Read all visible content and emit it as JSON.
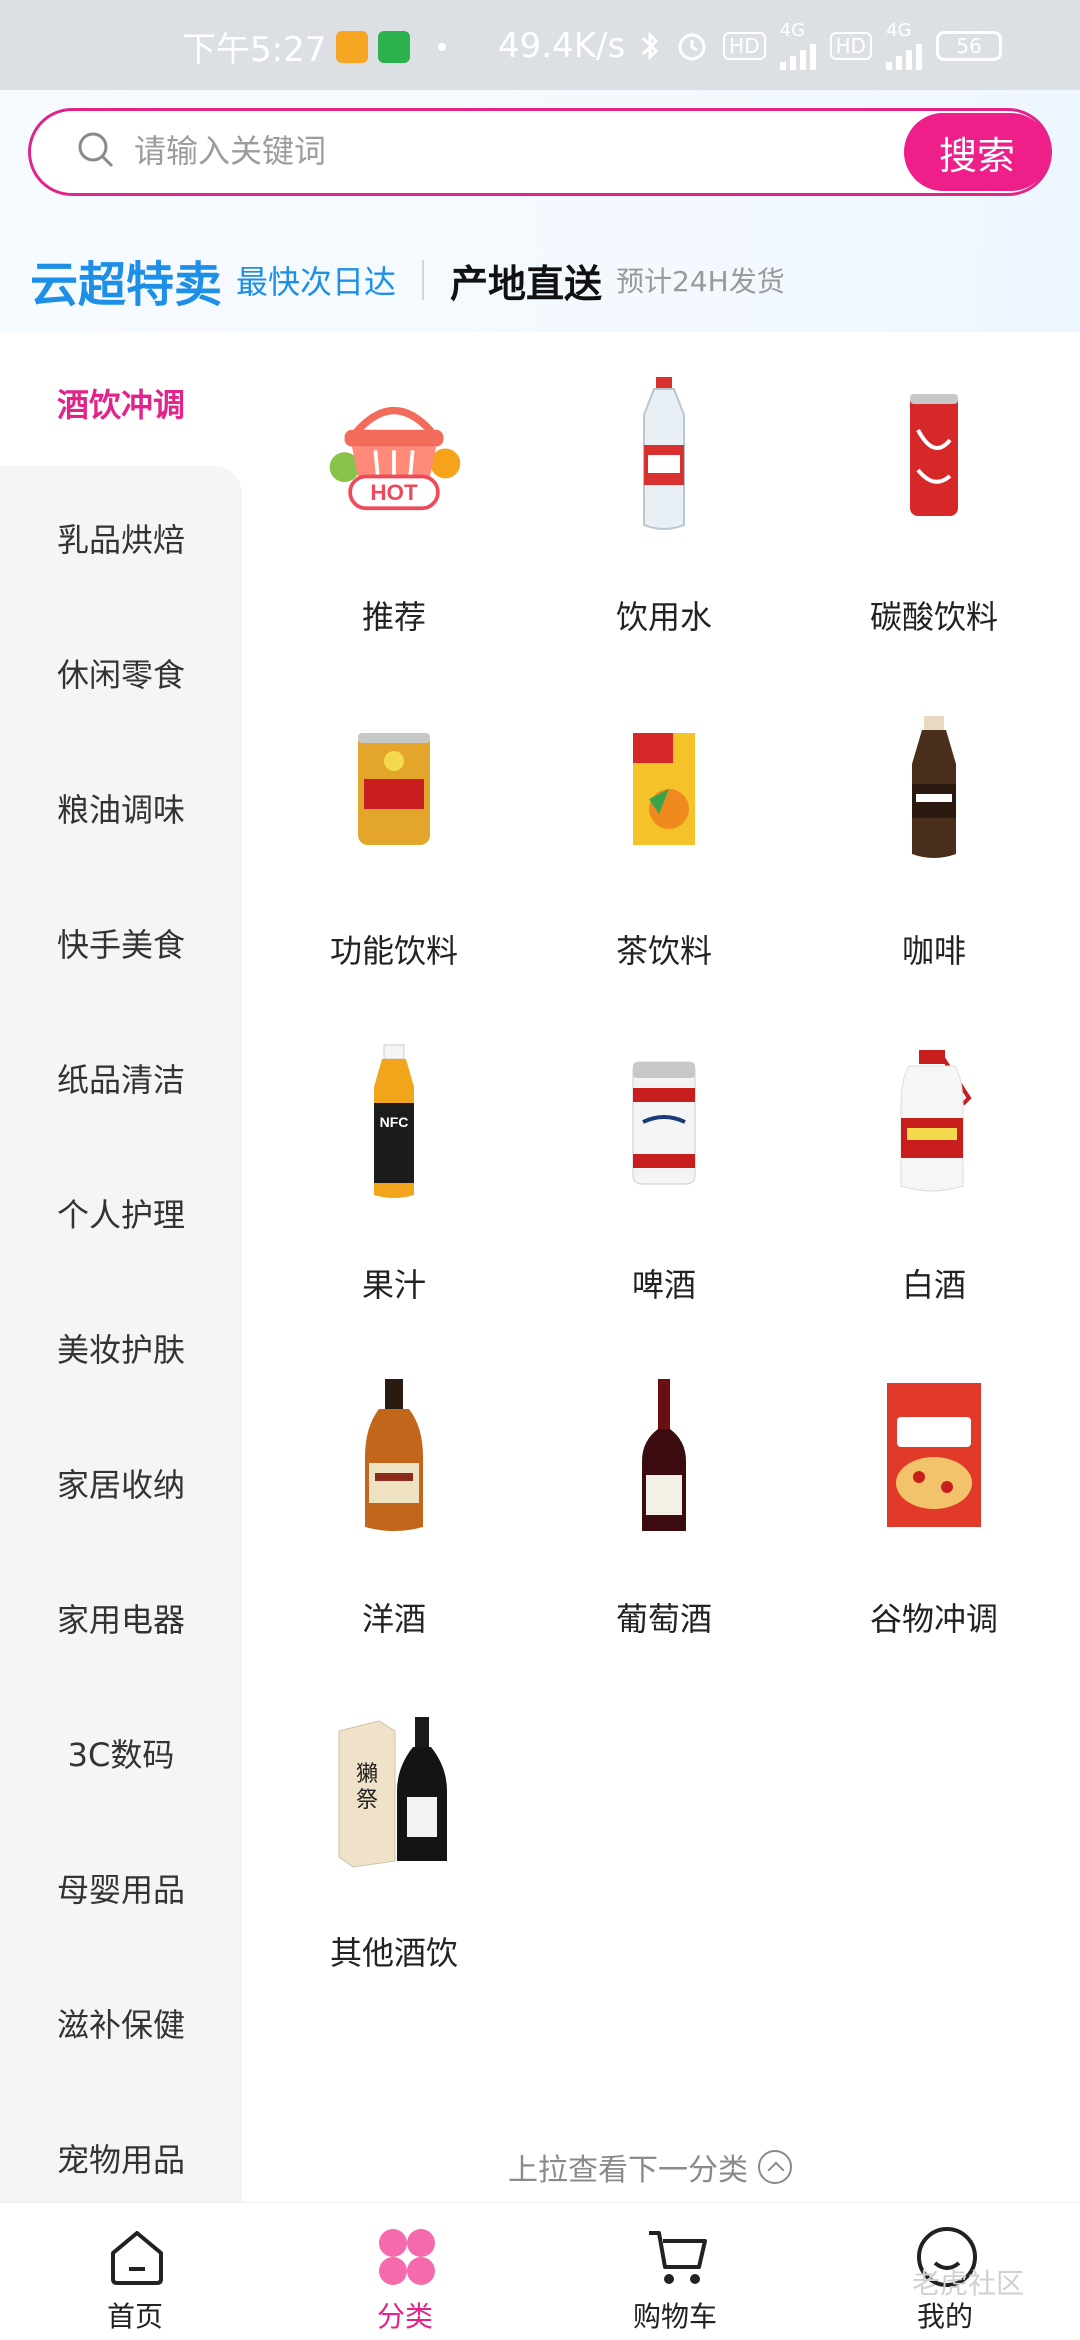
{
  "status_bar": {
    "time": "下午5:27",
    "net_speed": "49.4K/s",
    "hd1": "HD",
    "net1": "4G",
    "hd2": "HD",
    "net2": "4G",
    "battery": "56"
  },
  "search": {
    "placeholder": "请输入关键词",
    "button_label": "搜索"
  },
  "promo": {
    "title1": "云超特卖",
    "sub1": "最快次日达",
    "title2": "产地直送",
    "sub2": "预计24H发货"
  },
  "sidebar": {
    "items": [
      {
        "label": "酒饮冲调",
        "active": true
      },
      {
        "label": "乳品烘焙"
      },
      {
        "label": "休闲零食"
      },
      {
        "label": "粮油调味"
      },
      {
        "label": "快手美食"
      },
      {
        "label": "纸品清洁"
      },
      {
        "label": "个人护理"
      },
      {
        "label": "美妆护肤"
      },
      {
        "label": "家居收纳"
      },
      {
        "label": "家用电器"
      },
      {
        "label": "3C数码"
      },
      {
        "label": "母婴用品"
      },
      {
        "label": "滋补保健"
      },
      {
        "label": "宠物用品"
      }
    ]
  },
  "grid": {
    "items": [
      {
        "label": "推荐",
        "icon": "hot-basket-icon",
        "badge": "HOT"
      },
      {
        "label": "饮用水",
        "icon": "water-bottle-icon"
      },
      {
        "label": "碳酸饮料",
        "icon": "cola-can-icon"
      },
      {
        "label": "功能饮料",
        "icon": "energy-drink-can-icon"
      },
      {
        "label": "茶饮料",
        "icon": "tea-box-icon"
      },
      {
        "label": "咖啡",
        "icon": "coffee-bottle-icon"
      },
      {
        "label": "果汁",
        "icon": "juice-bottle-icon"
      },
      {
        "label": "啤酒",
        "icon": "beer-can-icon"
      },
      {
        "label": "白酒",
        "icon": "baijiu-bottle-icon"
      },
      {
        "label": "洋酒",
        "icon": "whisky-bottle-icon"
      },
      {
        "label": "葡萄酒",
        "icon": "wine-bottle-icon"
      },
      {
        "label": "谷物冲调",
        "icon": "cereal-bag-icon"
      },
      {
        "label": "其他酒饮",
        "icon": "sake-bottle-icon"
      }
    ]
  },
  "pull_hint": "上拉查看下一分类",
  "bottom_nav": {
    "items": [
      {
        "label": "首页",
        "icon": "home-icon"
      },
      {
        "label": "分类",
        "icon": "category-icon",
        "active": true
      },
      {
        "label": "购物车",
        "icon": "cart-icon"
      },
      {
        "label": "我的",
        "icon": "profile-icon"
      }
    ]
  },
  "watermark": "老虎社区",
  "colors": {
    "accent": "#e2238a",
    "promo_blue": "#1e8fe6"
  }
}
